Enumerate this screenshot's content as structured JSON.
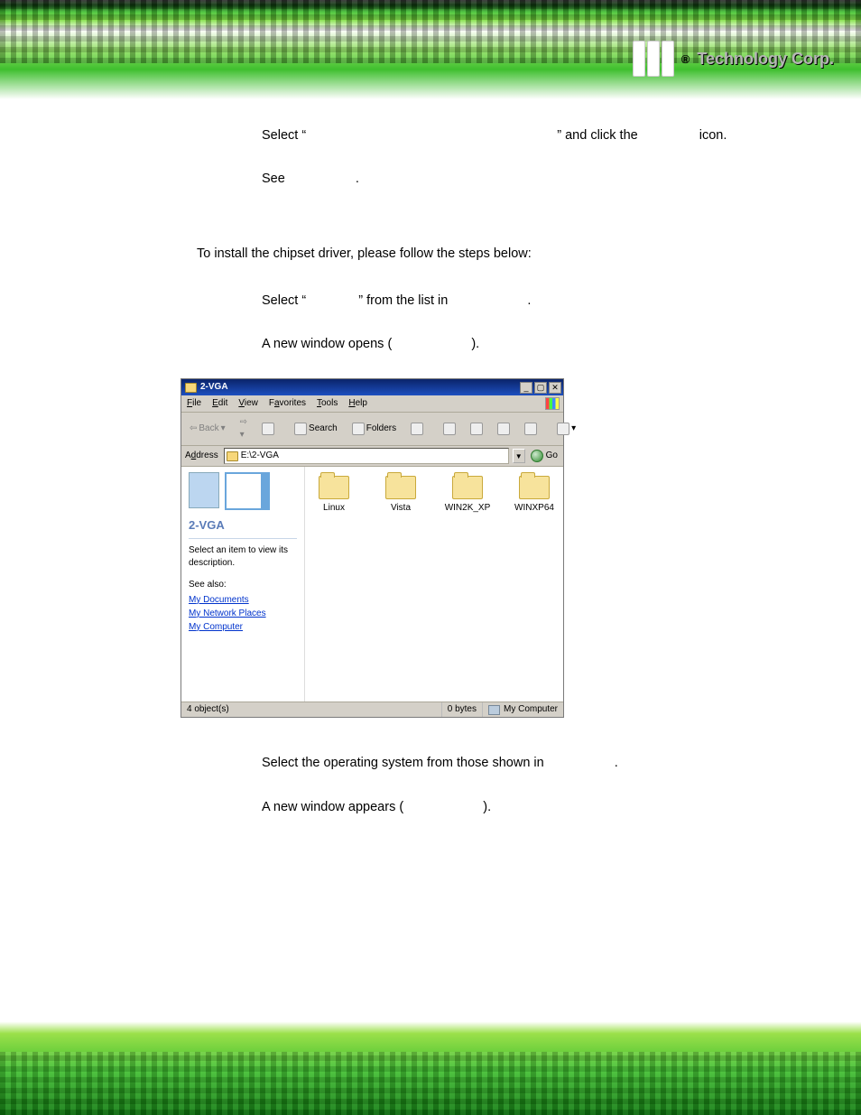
{
  "header": {
    "brand": "Technology Corp.",
    "registered": "®"
  },
  "body": {
    "line1": {
      "select_prefix": "Select “",
      "select_close": "” and click the",
      "icon_word": "icon."
    },
    "line2": {
      "see": "See",
      "dot": "."
    },
    "intro": "To install the chipset driver, please follow the steps below:",
    "step1": {
      "select_prefix": "Select “",
      "select_close": "” from the list in",
      "dot": "."
    },
    "step2": {
      "text": "A new window opens (",
      "close": ")."
    },
    "step3": {
      "text": "Select the operating system from those shown in",
      "dot": "."
    },
    "step4": {
      "text": "A new window appears (",
      "close": ")."
    }
  },
  "oswindow": {
    "title": "2-VGA",
    "menus": [
      "File",
      "Edit",
      "View",
      "Favorites",
      "Tools",
      "Help"
    ],
    "toolbar": {
      "back": "Back",
      "search": "Search",
      "folders": "Folders"
    },
    "address_label": "Address",
    "address_value": "E:\\2-VGA",
    "go": "Go",
    "left": {
      "panel_name": "2-VGA",
      "desc": "Select an item to view its description.",
      "see_also": "See also:",
      "links": [
        "My Documents",
        "My Network Places",
        "My Computer"
      ]
    },
    "folders": [
      "Linux",
      "Vista",
      "WIN2K_XP",
      "WINXP64"
    ],
    "status": {
      "objects": "4 object(s)",
      "bytes": "0 bytes",
      "location": "My Computer"
    }
  }
}
